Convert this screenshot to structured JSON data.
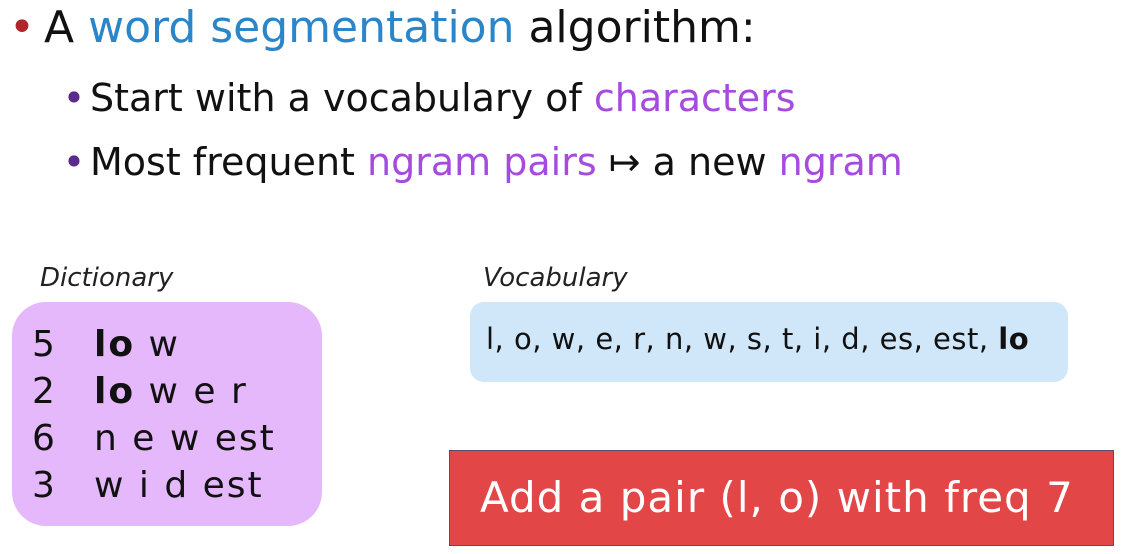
{
  "bullets": {
    "line1": {
      "prefix": "A ",
      "highlight": "word segmentation",
      "suffix": " algorithm:"
    },
    "line2": {
      "prefix": "Start with a vocabulary of ",
      "highlight": "characters"
    },
    "line3": {
      "prefix": "Most frequent ",
      "highlight1": "ngram pairs",
      "arrow": " ↦ a new ",
      "highlight2": "ngram"
    }
  },
  "dictionary": {
    "caption": "Dictionary",
    "rows": [
      {
        "count": "5",
        "bold": "lo",
        "rest": " w"
      },
      {
        "count": "2",
        "bold": "lo",
        "rest": " w e r"
      },
      {
        "count": "6",
        "bold": "",
        "rest": "n e w est"
      },
      {
        "count": "3",
        "bold": "",
        "rest": "w i d est"
      }
    ]
  },
  "vocabulary": {
    "caption": "Vocabulary",
    "items": "l, o, w, e, r, n, w, s, t, i, d, es, est, ",
    "new_item": "lo"
  },
  "action": {
    "text": "Add a pair (l, o) with freq 7"
  },
  "colors": {
    "blue": "#2a86c8",
    "purple": "#a64ae0",
    "dict_bg": "#e4b8fb",
    "vocab_bg": "#cfe7f9",
    "action_bg": "#e24647"
  }
}
